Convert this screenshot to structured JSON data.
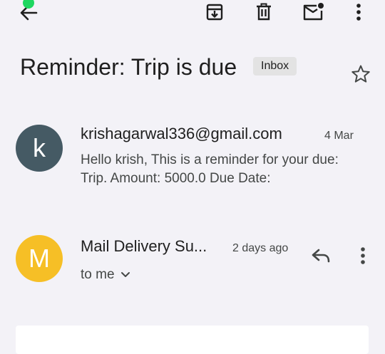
{
  "toolbar": {
    "back_icon": "arrow-left-icon",
    "archive_icon": "archive-icon",
    "delete_icon": "trash-icon",
    "mark_unread_icon": "mail-unread-icon",
    "more_icon": "more-vert-icon"
  },
  "thread": {
    "subject": "Reminder: Trip is due",
    "label": "Inbox",
    "star_icon": "star-outline-icon"
  },
  "messages": [
    {
      "avatar_letter": "k",
      "avatar_color": "#455a64",
      "sender": "krishagarwal336@gmail.com",
      "date": "4 Mar",
      "snippet": "Hello krish, This is a reminder for your due: Trip. Amount: 5000.0 Due Date:"
    },
    {
      "avatar_letter": "M",
      "avatar_color": "#f6bf26",
      "sender": "Mail Delivery Su...",
      "date": "2 days ago",
      "recipient": "to me",
      "reply_icon": "reply-icon",
      "more_icon": "more-vert-icon"
    }
  ]
}
